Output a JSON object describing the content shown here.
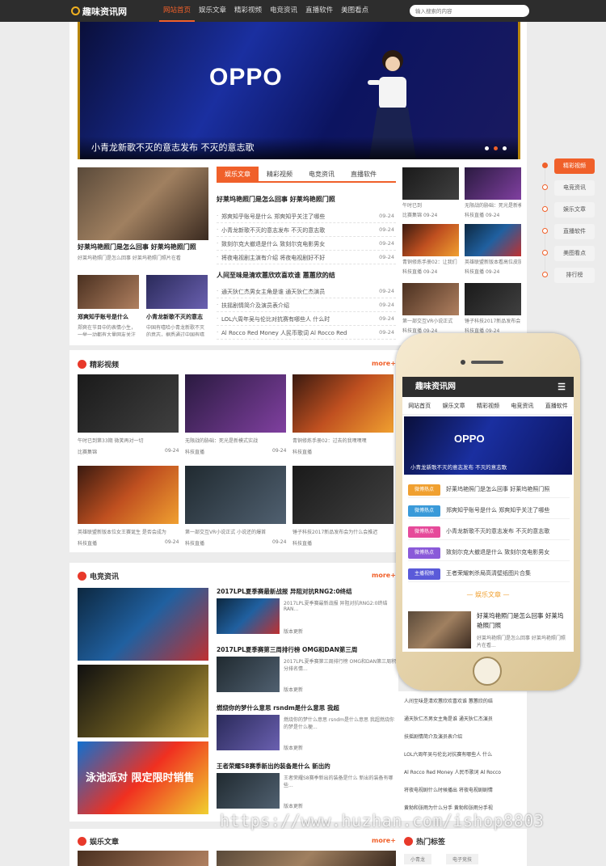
{
  "site": {
    "logo": "趣味资讯网",
    "search_placeholder": "输入搜索的内容"
  },
  "nav": [
    "网站首页",
    "娱乐文章",
    "精彩视频",
    "电竞资讯",
    "直播软件",
    "美图看点"
  ],
  "hero": {
    "brand": "OPPO",
    "caption": "小青龙新歌不灭的意志发布 不灭的意志歌"
  },
  "feature": {
    "title": "好莱坞艳照门是怎么回事 好莱坞艳照门照",
    "desc": "好莱坞艳照门是怎么回事 好莱坞艳照门照片在看",
    "sub1": {
      "title": "郑爽知乎账号是什么",
      "desc": "郑爽在节目中的表情小生，一举一动都有大量网友关注"
    },
    "sub2": {
      "title": "小青龙新歌不灭的意志",
      "desc": "中国有嘻哈小青龙新歌不灭的意志，据悉通过中国有嘻哈成人"
    }
  },
  "tabs": [
    "娱乐文章",
    "精彩视频",
    "电竞资讯",
    "直播软件"
  ],
  "list1": {
    "headline": "好莱坞艳照门是怎么回事 好莱坞艳照门照",
    "items": [
      {
        "text": "郑爽知乎账号是什么 郑爽知乎关注了哪些",
        "date": "09-24"
      },
      {
        "text": "小青龙新歌不灭的意志发布 不灭的意志歌",
        "date": "09-24"
      },
      {
        "text": "致刻尔克大撤退是什么 致刻尔克电影男女",
        "date": "09-24"
      },
      {
        "text": "将夜电视剧主演有介绍 将夜电视剧好不好",
        "date": "09-24"
      }
    ]
  },
  "list2": {
    "headline": "人间至味是清欢蕙欣欢喜欢谁 蕙蕙欣的结",
    "items": [
      {
        "text": "通天狄仁杰男女主角是谁 通天狄仁杰演员",
        "date": "09-24"
      },
      {
        "text": "扶摇剧情简介及演员表介绍",
        "date": "09-24"
      },
      {
        "text": "LOL六周年吴与伦比对抗赛有哪些人 什么时",
        "date": "09-24"
      },
      {
        "text": "Al Rocco Red Money 人民币歌词 Al Rocco Red",
        "date": "09-24"
      }
    ]
  },
  "right_thumbs": [
    {
      "title": "午时已到",
      "tag": "比赛集锦",
      "date": "09-24"
    },
    {
      "title": "无限战的胁础：死光是新模式",
      "tag": "科技直播",
      "date": "09-24"
    },
    {
      "title": "青铜修炼手册02：让我们",
      "tag": "科技直播",
      "date": "09-24"
    },
    {
      "title": "英雄联盟新版本看高位皮肤",
      "tag": "科技直播",
      "date": "09-24"
    },
    {
      "title": "第一部交互VR小说正式",
      "tag": "科技直播",
      "date": "09-24"
    },
    {
      "title": "锤子科技2017新品发布会",
      "tag": "科技直播",
      "date": "09-24"
    }
  ],
  "side_nav": [
    "精彩视频",
    "电竞资讯",
    "娱乐文章",
    "直播软件",
    "美图看点",
    "排行榜"
  ],
  "video_section": {
    "title": "精彩视频",
    "more": "more+",
    "cards": [
      {
        "title": "午时已到第33期 微笑再对一切",
        "tag": "比赛集锦",
        "date": "09-24"
      },
      {
        "title": "无限战的胁础：死光是新模式实战",
        "tag": "科技直播",
        "date": "09-24"
      },
      {
        "title": "青铜修炼手册02：过去的我嘿嘿嘿",
        "tag": "科技直播",
        "date": "09-24"
      },
      {
        "title": "英雄联盟新版本位女王赛诞生 是否会成为",
        "tag": "科技直播",
        "date": "09-24"
      },
      {
        "title": "第一部交互VR小说正式 小说还的爆首",
        "tag": "科技直播",
        "date": "09-24"
      },
      {
        "title": "锤子科技2017新品发布会为什么会推迟",
        "tag": "科技直播",
        "date": "09-24"
      }
    ]
  },
  "esports_section": {
    "title": "电竞资讯",
    "more": "more+",
    "items": [
      {
        "title": "2017LPL夏季赛最新战报 异阻对抗RNG2:0终结",
        "desc": "2017LPL夏季赛最新战报 异阻对抗RNG2:0终结RAN...",
        "tag": "版本更新"
      },
      {
        "title": "2017LPL夏季赛第三周排行榜 OMG和DAN第三周",
        "desc": "2017LPL夏季赛第三周排行榜 OMG和DAN第三周积分排名情...",
        "tag": "版本更新"
      },
      {
        "title": "燃烧你的梦什么意思 rsndm是什么意思 我超",
        "desc": "燃烧你的梦什么意思 rsndm是什么意思 我超燃烧你的梦是什么梗...",
        "tag": "版本更新"
      },
      {
        "title": "王者荣耀S8赛季新出的装备是什么 新出的",
        "desc": "王者荣耀S8赛季新出的装备是什么 新出的装备有哪些...",
        "tag": "版本更新"
      }
    ],
    "banner": "泳池派对 限定限时销售"
  },
  "below_phone_list": [
    "人间至味是清欢蕙欣欢喜欢谁 蕙蕙欣的结",
    "通天狄仁杰男女主角是谁 通天狄仁杰演员",
    "扶摇剧情简介及演员表介绍",
    "LOL六周年吴与伦比对抗赛有哪些人 什么",
    "Al Rocco Red Money 人民币歌词 Al Rocco",
    "将夜电视剧什么时候播出 将夜电视剧剧情",
    "黄勃和张雨为什么分手 黄勃和张雨分手视"
  ],
  "ent_section": {
    "title": "娱乐文章",
    "more": "more+",
    "hot_title": "热门标签",
    "tags": [
      "小青龙",
      "电子竞技"
    ]
  },
  "mobile": {
    "logo": "趣味资讯网",
    "nav": [
      "网站首页",
      "娱乐文章",
      "精彩视频",
      "电竞资讯",
      "直播软件"
    ],
    "hero_caption": "小青龙新歌不灭的意志发布 不灭的意志歌",
    "rows": [
      {
        "badge": "微博热点",
        "text": "好莱坞艳照门是怎么回事 好莱坞艳照门照",
        "color": "#f0a030"
      },
      {
        "badge": "微博热点",
        "text": "郑爽知乎账号是什么 郑爽知乎关注了哪些",
        "color": "#3a9ad9"
      },
      {
        "badge": "微博热点",
        "text": "小青龙新歌不灭的意志发布 不灭的意志歌",
        "color": "#e64a9a"
      },
      {
        "badge": "微博热点",
        "text": "致刻尔克大撤退是什么 致刻尔克电影男女",
        "color": "#8a5ad9"
      },
      {
        "badge": "主播视频",
        "text": "王者荣耀刺杀局高清壁纸图片合集",
        "color": "#5a5ad9"
      }
    ],
    "section_title": "娱乐文章",
    "card": {
      "title": "好莱坞艳照门是怎么回事 好莱坞艳照门照",
      "desc": "好莱坞艳照门是怎么回事 好莱坞艳照门照片在看..."
    }
  },
  "watermark": "https://www.huzhan.com/ishop8803",
  "colors": {
    "accent": "#f0602a",
    "topbar": "#2d2d2d"
  }
}
